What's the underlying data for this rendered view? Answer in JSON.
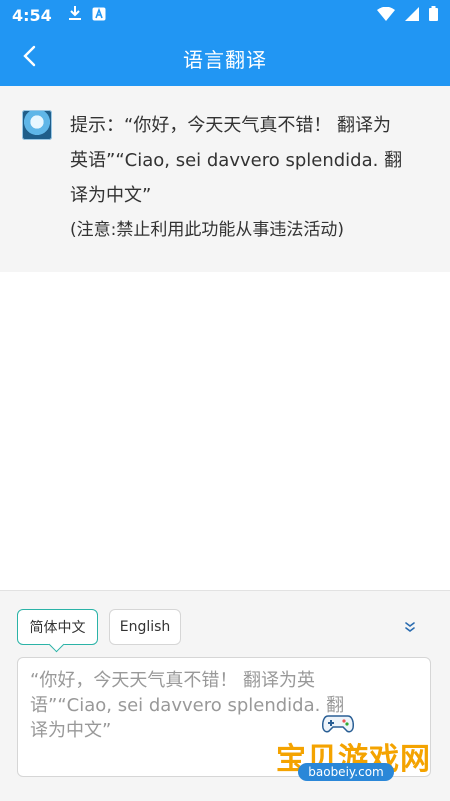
{
  "status": {
    "time": "4:54"
  },
  "appbar": {
    "title": "语言翻译"
  },
  "tip": {
    "line1": "提示：“你好，今天天气真不错！ 翻译为",
    "line2": "英语”“Ciao, sei davvero splendida. 翻",
    "line3": "译为中文”",
    "note": "(注意:禁止利用此功能从事违法活动)"
  },
  "languages": {
    "source": "简体中文",
    "target": "English"
  },
  "input": {
    "line1": "“你好，今天天气真不错！ 翻译为英",
    "line2": "语”“Ciao, sei davvero splendida. 翻",
    "line3": "译为中文”"
  },
  "watermark": {
    "brand": "宝贝游戏网",
    "site": "baobeiy.com"
  },
  "colors": {
    "primary": "#2196f3",
    "accent": "#2bb3a7",
    "watermark": "#f4a300"
  },
  "icons": [
    "download-icon",
    "app-notification-icon",
    "wifi-icon",
    "signal-icon",
    "battery-icon",
    "back-arrow-icon",
    "double-chevron-down-icon"
  ]
}
